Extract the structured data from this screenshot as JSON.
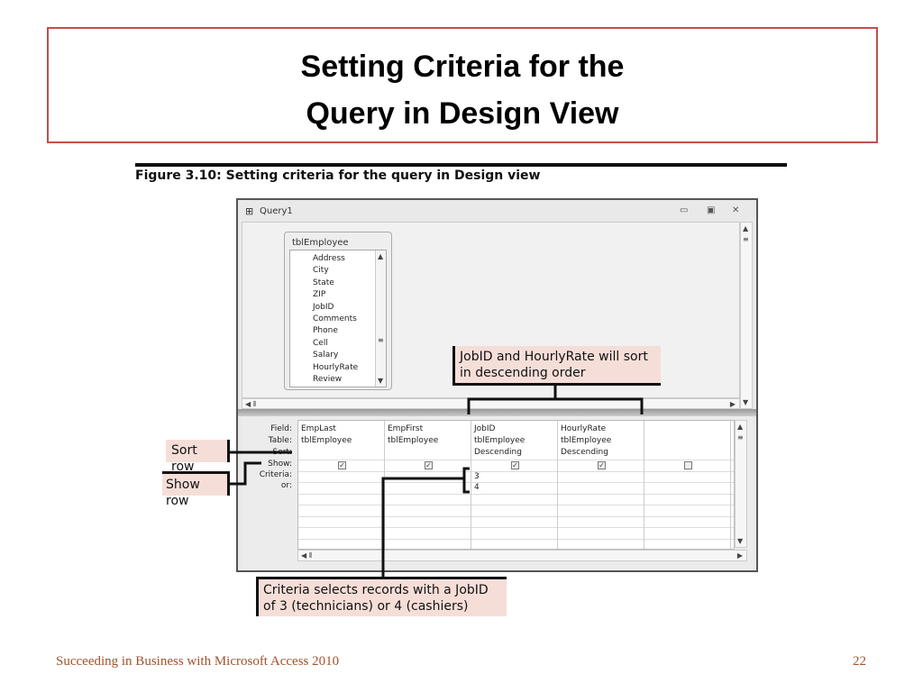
{
  "slide": {
    "title_line1": "Setting Criteria for the",
    "title_line2": "Query in Design View",
    "figure_caption": "Figure 3.10: Setting criteria for the query in Design view",
    "footer": "Succeeding in Business with Microsoft Access 2010",
    "page_number": "22",
    "accent_color": "#c0504d"
  },
  "window": {
    "title": "Query1",
    "table": {
      "name": "tblEmployee",
      "fields": [
        "Address",
        "City",
        "State",
        "ZIP",
        "JobID",
        "Comments",
        "Phone",
        "Cell",
        "Salary",
        "HourlyRate",
        "Review"
      ]
    },
    "grid": {
      "row_labels": [
        "Field:",
        "Table:",
        "Sort:",
        "Show:",
        "Criteria:",
        "or:"
      ],
      "columns": [
        {
          "field": "EmpLast",
          "table": "tblEmployee",
          "sort": "",
          "show": true,
          "criteria": "",
          "or": ""
        },
        {
          "field": "EmpFirst",
          "table": "tblEmployee",
          "sort": "",
          "show": true,
          "criteria": "",
          "or": ""
        },
        {
          "field": "JobID",
          "table": "tblEmployee",
          "sort": "Descending",
          "show": true,
          "criteria": "3",
          "or": "4"
        },
        {
          "field": "HourlyRate",
          "table": "tblEmployee",
          "sort": "Descending",
          "show": true,
          "criteria": "",
          "or": ""
        },
        {
          "field": "",
          "table": "",
          "sort": "",
          "show": false,
          "criteria": "",
          "or": ""
        }
      ]
    }
  },
  "callouts": {
    "sort_desc": "JobID and HourlyRate will sort in descending order",
    "sort_row": "Sort row",
    "show_row": "Show row",
    "criteria": "Criteria selects records with a JobID of 3 (technicians) or 4 (cashiers)"
  }
}
